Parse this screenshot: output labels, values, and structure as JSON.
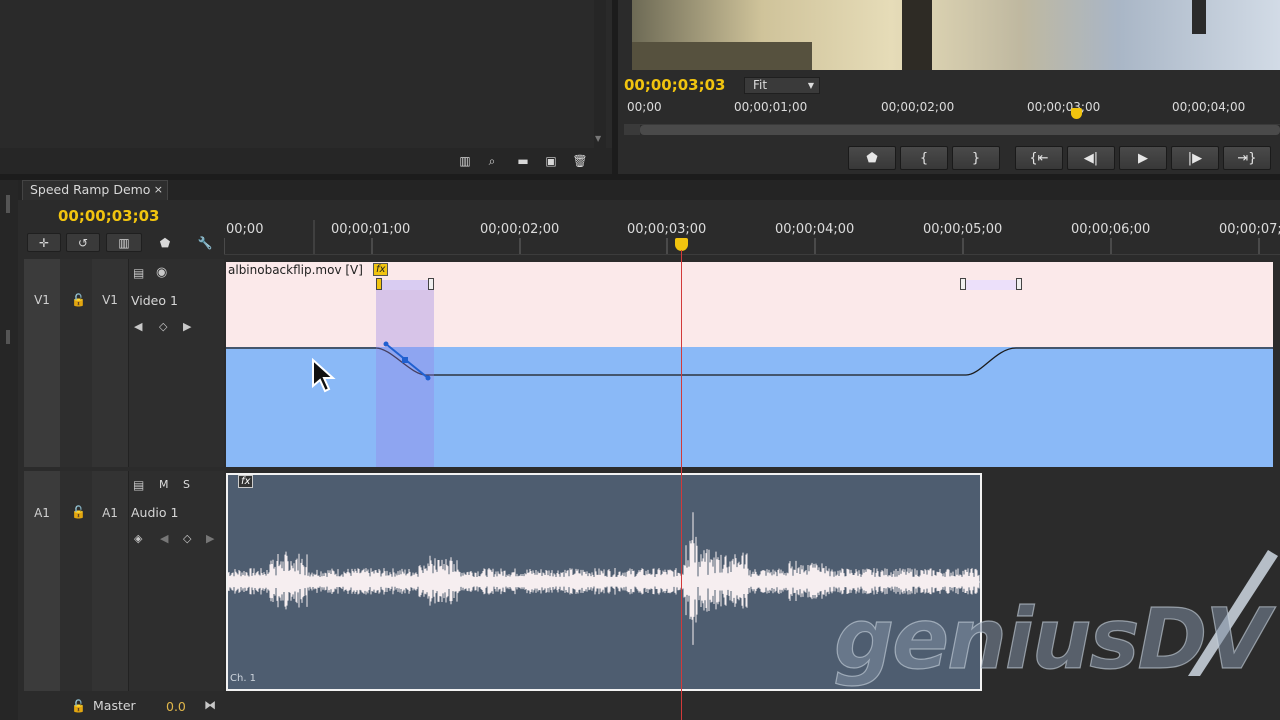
{
  "monitor": {
    "timecode": "00;00;03;03",
    "fit_value": "Fit",
    "ruler": [
      "00;00",
      "00;00;01;00",
      "00;00;02;00",
      "00;00;03;00",
      "00;00;04;00"
    ]
  },
  "sequence": {
    "tab_label": "Speed Ramp Demo",
    "timecode": "00;00;03;03",
    "ruler": [
      "00;00",
      "00;00;01;00",
      "00;00;02;00",
      "00;00;03;00",
      "00;00;04;00",
      "00;00;05;00",
      "00;00;06;00",
      "00;00;07;"
    ]
  },
  "tracks": {
    "video": {
      "id": "V1",
      "target": "V1",
      "name": "Video 1"
    },
    "audio": {
      "id": "A1",
      "target": "A1",
      "name": "Audio 1",
      "mute": "M",
      "solo": "S",
      "channel": "Ch. 1"
    },
    "master": {
      "name": "Master",
      "value": "0.0"
    }
  },
  "clip": {
    "video_name": "albinobackflip.mov [V]",
    "fx_badge": "fx"
  },
  "watermark": "geniusDV",
  "colors": {
    "timecode": "#f1c40f",
    "video_clip": "#fbe9ea",
    "speed_fill": "#8ab9f7",
    "audio_clip": "#4e5d70",
    "playhead": "#d23a3a"
  }
}
